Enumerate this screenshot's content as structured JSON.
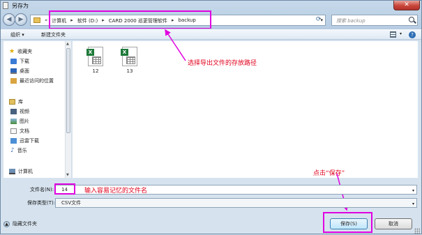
{
  "window": {
    "title": "另存为",
    "close_label": "✕"
  },
  "address": {
    "crumbs": [
      "计算机",
      "软件 (D:)",
      "CARD 2000 巡更管理软件",
      "backup"
    ],
    "search_placeholder": "搜索 backup"
  },
  "toolbar": {
    "organize": "组织 ▾",
    "new_folder": "新建文件夹"
  },
  "sidebar": {
    "favorites": "收藏夹",
    "favorites_items": [
      "下载",
      "桌面",
      "最近访问的位置"
    ],
    "libraries": "库",
    "library_items": [
      "视频",
      "图片",
      "文档",
      "迅雷下载",
      "音乐"
    ],
    "computer": "计算机"
  },
  "files": [
    {
      "name": "12",
      "icon": "excel-csv-file-icon"
    },
    {
      "name": "13",
      "icon": "excel-csv-file-icon"
    }
  ],
  "annotations": {
    "path_note": "选择导出文件的存放路径",
    "filename_note": "输入容易记忆的文件名",
    "save_note": "点击“保存”"
  },
  "form": {
    "filename_label": "文件名(N):",
    "filename_value": "14",
    "filetype_label": "保存类型(T):",
    "filetype_value": "CSV文件"
  },
  "footer": {
    "hide_folders": "隐藏文件夹",
    "save": "保存(S)",
    "cancel": "取消"
  },
  "colors": {
    "annotation_red": "#e0001c",
    "highlight_magenta": "#e000e0"
  }
}
